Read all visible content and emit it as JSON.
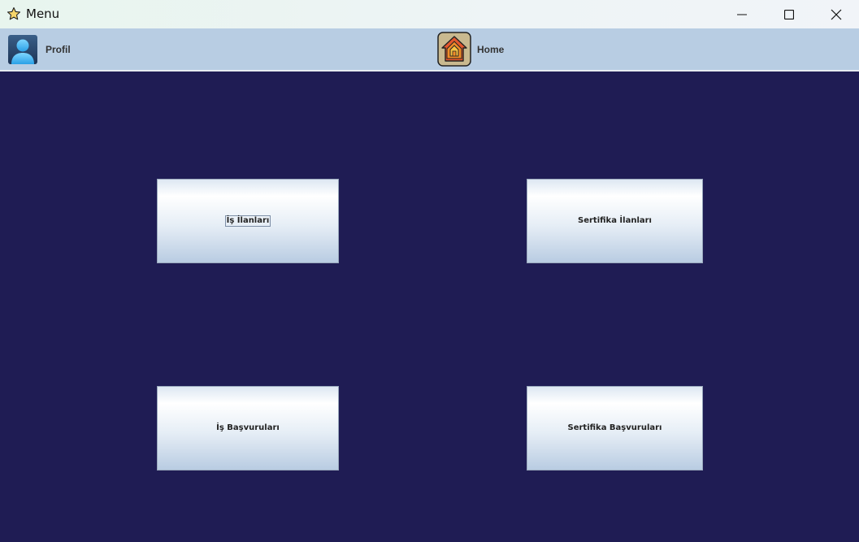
{
  "window": {
    "title": "Menu",
    "icon": "star-icon"
  },
  "toolbar": {
    "profile_label": "Profil",
    "profile_icon": "user-avatar-icon",
    "home_label": "Home",
    "home_icon": "house-icon"
  },
  "menu": {
    "buttons": [
      {
        "label": "İş İlanları",
        "focused": true
      },
      {
        "label": "Sertifika İlanları",
        "focused": false
      },
      {
        "label": "İş Başvuruları",
        "focused": false
      },
      {
        "label": "Sertifika Başvuruları",
        "focused": false
      }
    ]
  },
  "colors": {
    "background": "#1f1c54",
    "toolbar": "#b8cde3",
    "button_gradient_bottom": "#b9cce2"
  }
}
